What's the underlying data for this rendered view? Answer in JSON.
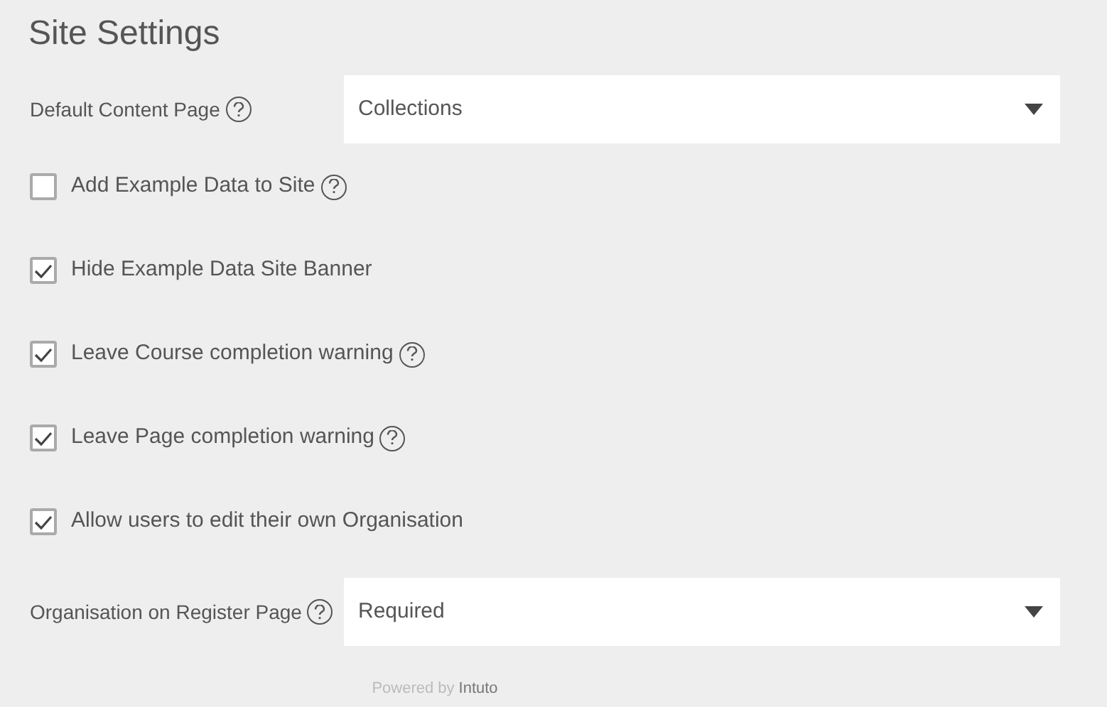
{
  "title": "Site Settings",
  "settings": [
    {
      "kind": "select",
      "label": "Default Content Page",
      "help": true,
      "value": "Collections"
    },
    {
      "kind": "checkbox",
      "label": "Add Example Data to Site",
      "help": true,
      "checked": false
    },
    {
      "kind": "checkbox",
      "label": "Hide Example Data Site Banner",
      "help": false,
      "checked": true
    },
    {
      "kind": "checkbox",
      "label": "Leave Course completion warning",
      "help": true,
      "checked": true
    },
    {
      "kind": "checkbox",
      "label": "Leave Page completion warning",
      "help": true,
      "checked": true
    },
    {
      "kind": "checkbox",
      "label": "Allow users to edit their own Organisation",
      "help": false,
      "checked": true
    },
    {
      "kind": "select",
      "label": "Organisation on Register Page",
      "help": true,
      "value": "Required"
    }
  ],
  "footer": {
    "prefix": "Powered by",
    "brand": "Intuto"
  }
}
